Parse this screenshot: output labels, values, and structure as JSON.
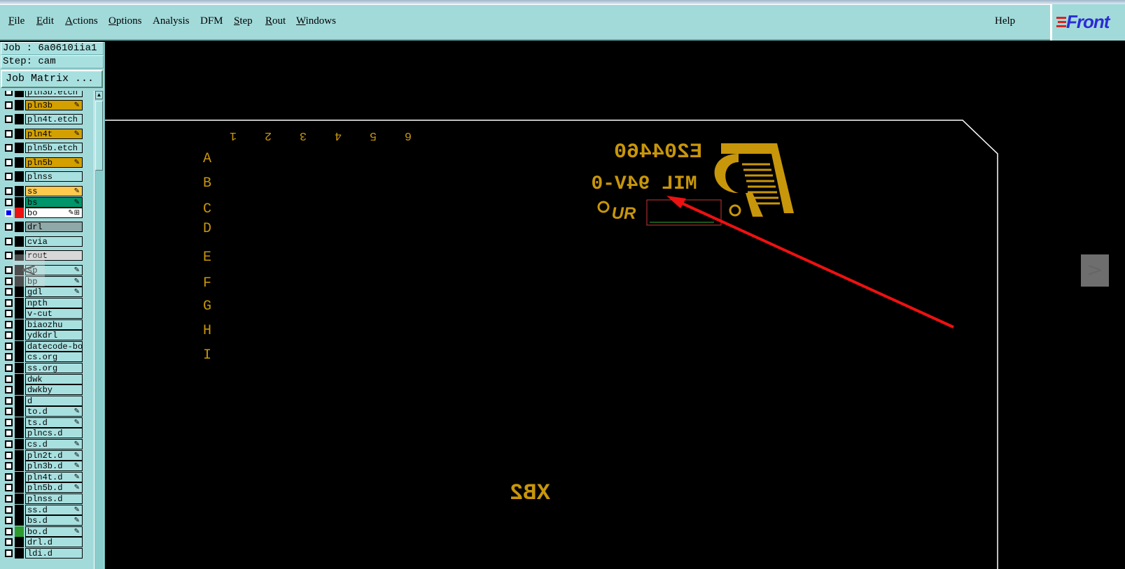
{
  "menu": {
    "items": [
      {
        "label": "File",
        "u": "F",
        "rest": "ile"
      },
      {
        "label": "Edit",
        "u": "E",
        "rest": "dit"
      },
      {
        "label": "Actions",
        "u": "A",
        "rest": "ctions"
      },
      {
        "label": "Options",
        "u": "O",
        "rest": "ptions"
      },
      {
        "label": "Analysis",
        "u": "",
        "rest": "Analysis"
      },
      {
        "label": "DFM",
        "u": "",
        "rest": "DFM"
      },
      {
        "label": "Step",
        "u": "S",
        "rest": "tep"
      },
      {
        "label": "Rout",
        "u": "R",
        "rest": "out"
      },
      {
        "label": "Windows",
        "u": "W",
        "rest": "indows"
      }
    ],
    "help": "Help"
  },
  "logo": {
    "text": "Front"
  },
  "sidebar": {
    "job": "Job : 6a0610iia1",
    "step": "Step: cam",
    "job_matrix": "Job Matrix ..."
  },
  "layers": [
    {
      "name": "pln3b.etch",
      "color": "#a8e0e0",
      "swatch": "#000",
      "flag": "",
      "partial": true
    },
    {
      "name": "pln3b",
      "color": "#d4a000",
      "swatch": "#000",
      "flag": "edit"
    },
    {
      "name": "pln4t.etch",
      "color": "#a8e0e0",
      "swatch": "#000",
      "flag": ""
    },
    {
      "name": "pln4t",
      "color": "#d4a000",
      "swatch": "#000",
      "flag": "edit"
    },
    {
      "name": "pln5b.etch",
      "color": "#a8e0e0",
      "swatch": "#000",
      "flag": ""
    },
    {
      "name": "pln5b",
      "color": "#d4a000",
      "swatch": "#000",
      "flag": "edit"
    },
    {
      "name": "plnss",
      "color": "#a8e0e0",
      "swatch": "#000",
      "flag": ""
    },
    {
      "name": "ss",
      "color": "#ffc94d",
      "swatch": "#000",
      "flag": "edit"
    },
    {
      "name": "bs",
      "color": "#00956a",
      "swatch": "#000",
      "flag": "edit"
    },
    {
      "name": "bo",
      "color": "#ffffff",
      "swatch": "#ee1111",
      "flag": "edit-work",
      "checked": true
    },
    {
      "name": "drl",
      "color": "#8fa8a8",
      "swatch": "#000",
      "flag": ""
    },
    {
      "name": "cvia",
      "color": "#a8e0e0",
      "swatch": "#000",
      "flag": ""
    },
    {
      "name": "rout",
      "color": "#d8d8d8",
      "swatch": "#000",
      "flag": ""
    },
    {
      "name": "sp",
      "color": "#a8e0e0",
      "swatch": "#000",
      "flag": "edit"
    },
    {
      "name": "bp",
      "color": "#a8e0e0",
      "swatch": "#000",
      "flag": "edit"
    },
    {
      "name": "gdl",
      "color": "#a8e0e0",
      "swatch": "#000",
      "flag": "edit"
    },
    {
      "name": "npth",
      "color": "#a8e0e0",
      "swatch": "#000",
      "flag": ""
    },
    {
      "name": "v-cut",
      "color": "#a8e0e0",
      "swatch": "#000",
      "flag": ""
    },
    {
      "name": "biaozhu",
      "color": "#a8e0e0",
      "swatch": "#000",
      "flag": ""
    },
    {
      "name": "ydkdrl",
      "color": "#a8e0e0",
      "swatch": "#000",
      "flag": ""
    },
    {
      "name": "datecode-bo",
      "color": "#a8e0e0",
      "swatch": "#000",
      "flag": ""
    },
    {
      "name": "cs.org",
      "color": "#a8e0e0",
      "swatch": "#000",
      "flag": ""
    },
    {
      "name": "ss.org",
      "color": "#a8e0e0",
      "swatch": "#000",
      "flag": ""
    },
    {
      "name": "dwk",
      "color": "#a8e0e0",
      "swatch": "#000",
      "flag": ""
    },
    {
      "name": "dwkby",
      "color": "#a8e0e0",
      "swatch": "#000",
      "flag": ""
    },
    {
      "name": "d",
      "color": "#a8e0e0",
      "swatch": "#000",
      "flag": ""
    },
    {
      "name": "to.d",
      "color": "#a8e0e0",
      "swatch": "#000",
      "flag": "edit"
    },
    {
      "name": "ts.d",
      "color": "#a8e0e0",
      "swatch": "#000",
      "flag": "edit"
    },
    {
      "name": "plncs.d",
      "color": "#a8e0e0",
      "swatch": "#000",
      "flag": ""
    },
    {
      "name": "cs.d",
      "color": "#a8e0e0",
      "swatch": "#000",
      "flag": "edit"
    },
    {
      "name": "pln2t.d",
      "color": "#a8e0e0",
      "swatch": "#000",
      "flag": "edit"
    },
    {
      "name": "pln3b.d",
      "color": "#a8e0e0",
      "swatch": "#000",
      "flag": "edit"
    },
    {
      "name": "pln4t.d",
      "color": "#a8e0e0",
      "swatch": "#000",
      "flag": "edit"
    },
    {
      "name": "pln5b.d",
      "color": "#a8e0e0",
      "swatch": "#000",
      "flag": "edit"
    },
    {
      "name": "plnss.d",
      "color": "#a8e0e0",
      "swatch": "#000",
      "flag": ""
    },
    {
      "name": "ss.d",
      "color": "#a8e0e0",
      "swatch": "#000",
      "flag": "edit"
    },
    {
      "name": "bs.d",
      "color": "#a8e0e0",
      "swatch": "#000",
      "flag": "edit"
    },
    {
      "name": "bo.d",
      "color": "#a8e0e0",
      "swatch": "#2e9a2e",
      "flag": "edit"
    },
    {
      "name": "drl.d",
      "color": "#a8e0e0",
      "swatch": "#000",
      "flag": ""
    },
    {
      "name": "ldi.d",
      "color": "#a8e0e0",
      "swatch": "#000",
      "flag": ""
    }
  ],
  "canvas": {
    "col_markers": [
      "1",
      "2",
      "3",
      "4",
      "5",
      "6"
    ],
    "row_markers": [
      "A",
      "B",
      "C",
      "D",
      "E",
      "F",
      "G",
      "H",
      "I"
    ],
    "ul_number": "E204460",
    "grade": "MIL 94V-0",
    "ur_mark": "UR",
    "bottom_text": "XB2",
    "silk_color": "#c8960a",
    "outline_color": "#ffffff",
    "arrow_color": "#ee1111"
  },
  "nav": {
    "prev": "<",
    "next": ">"
  }
}
